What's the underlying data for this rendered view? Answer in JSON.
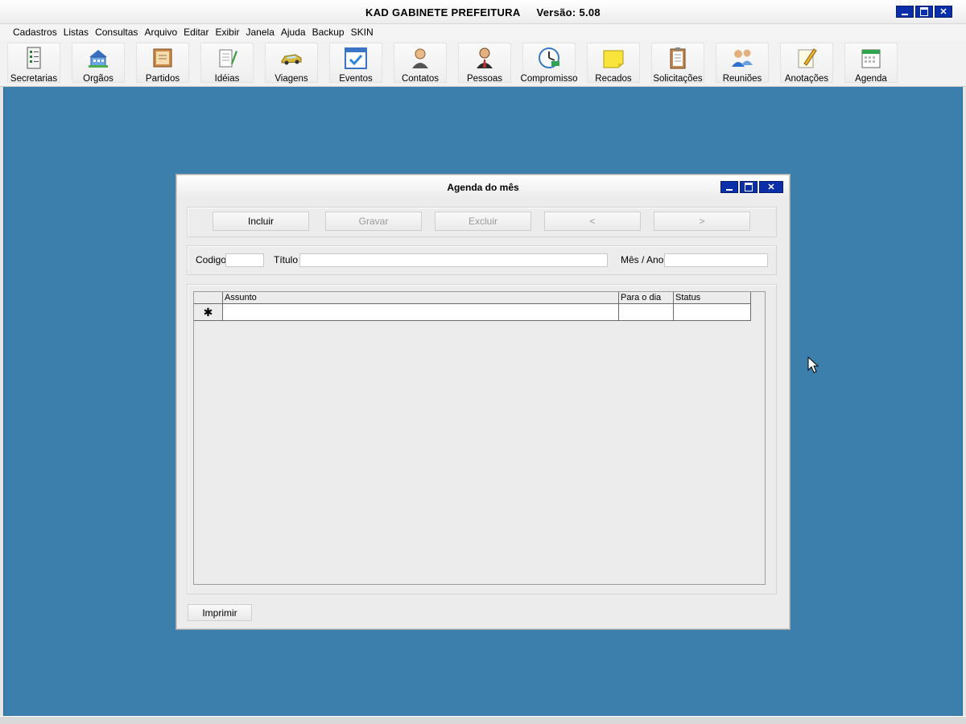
{
  "app": {
    "title": "KAD GABINETE PREFEITURA",
    "version": "Versão: 5.08"
  },
  "menu": [
    "Cadastros",
    "Listas",
    "Consultas",
    "Arquivo",
    "Editar",
    "Exibir",
    "Janela",
    "Ajuda",
    "Backup",
    "SKIN"
  ],
  "toolbar": [
    {
      "label": "Secretarias",
      "icon": "checklist-icon"
    },
    {
      "label": "Orgãos",
      "icon": "buildings-icon"
    },
    {
      "label": "Partidos",
      "icon": "certificate-icon"
    },
    {
      "label": "Idéias",
      "icon": "notepad-pencil-icon"
    },
    {
      "label": "Viagens",
      "icon": "car-icon"
    },
    {
      "label": "Eventos",
      "icon": "calendar-check-icon"
    },
    {
      "label": "Contatos",
      "icon": "person-icon"
    },
    {
      "label": "Pessoas",
      "icon": "businessman-icon"
    },
    {
      "label": "Compromisso",
      "icon": "clock-icon"
    },
    {
      "label": "Recados",
      "icon": "sticky-note-icon"
    },
    {
      "label": "Solicitações",
      "icon": "clipboard-icon"
    },
    {
      "label": "Reuniões",
      "icon": "people-group-icon"
    },
    {
      "label": "Anotações",
      "icon": "note-pencil-icon"
    },
    {
      "label": "Agenda",
      "icon": "agenda-icon"
    }
  ],
  "dialog": {
    "title": "Agenda do mês",
    "buttons": {
      "incluir": "Incluir",
      "gravar": "Gravar",
      "excluir": "Excluir",
      "prev": "<",
      "next": ">"
    },
    "fields": {
      "codigo_label": "Codigo",
      "codigo_value": "",
      "titulo_label": "Título",
      "titulo_value": "",
      "mes_ano_label": "Mês / Ano",
      "mes_ano_value": ""
    },
    "grid": {
      "columns": [
        "Assunto",
        "Para o dia",
        "Status"
      ],
      "new_row_marker": "✱"
    },
    "print_button": "Imprimir"
  },
  "colors": {
    "workspace": "#3d7fac",
    "window_button": "#0a2fa8"
  }
}
